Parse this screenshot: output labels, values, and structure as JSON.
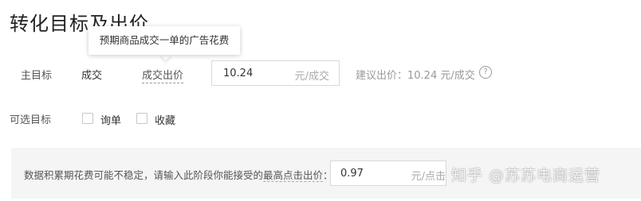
{
  "header": {
    "title": "转化目标及出价"
  },
  "tooltip": {
    "text": "预期商品成交一单的广告花费"
  },
  "main_goal": {
    "label": "主目标",
    "value": "成交",
    "bid_label": "成交出价",
    "bid_value": "10.24",
    "bid_unit": "元/成交",
    "suggestion": "建议出价：10.24 元/成交",
    "help_icon": "question-circle-icon"
  },
  "optional_goal": {
    "label": "可选目标",
    "options": [
      {
        "label": "询单",
        "checked": false
      },
      {
        "label": "收藏",
        "checked": false
      }
    ]
  },
  "accumulation": {
    "text_prefix": "数据积累期花费可能不稳定，请输入此阶段你能接受的",
    "text_emphasis": "最高点击出价",
    "text_suffix": "：",
    "value": "0.97",
    "unit": "元/点击"
  },
  "watermark": {
    "text": "知乎 @苏苏电商运营"
  }
}
